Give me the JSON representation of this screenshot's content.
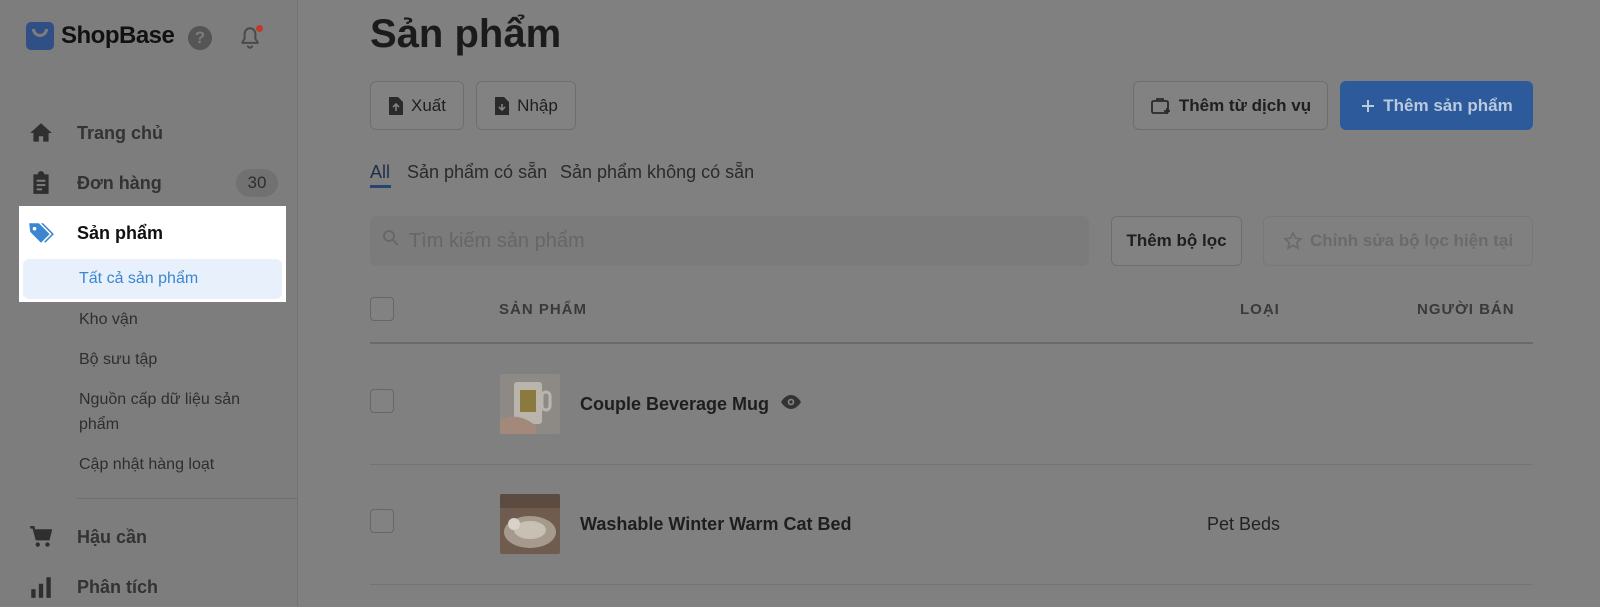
{
  "brand": {
    "name": "ShopBase"
  },
  "sidebar": {
    "items": [
      {
        "label": "Trang chủ",
        "icon": "home-icon"
      },
      {
        "label": "Đơn hàng",
        "icon": "clipboard-icon",
        "badge": "30"
      },
      {
        "label": "Sản phẩm",
        "icon": "tag-icon"
      },
      {
        "label": "Hậu cần",
        "icon": "cart-icon"
      },
      {
        "label": "Phân tích",
        "icon": "bar-chart-icon"
      }
    ],
    "subitems": [
      {
        "label": "Tất cả sản phẩm"
      },
      {
        "label": "Kho vận"
      },
      {
        "label": "Bộ sưu tập"
      },
      {
        "label": "Nguồn cấp dữ liệu sản phẩm"
      },
      {
        "label": "Cập nhật hàng loạt"
      }
    ]
  },
  "page": {
    "title": "Sản phẩm",
    "actions": {
      "export": "Xuất",
      "import": "Nhập",
      "add_from_service": "Thêm từ dịch vụ",
      "add_product": "Thêm sản phẩm"
    },
    "tabs": [
      "All",
      "Sản phẩm có sẵn",
      "Sản phẩm không có sẵn"
    ],
    "search": {
      "placeholder": "Tìm kiếm sản phẩm"
    },
    "filters": {
      "add": "Thêm bộ lọc",
      "edit_current": "Chỉnh sửa bộ lọc hiện tại"
    },
    "table": {
      "columns": [
        "SẢN PHẨM",
        "LOẠI",
        "NGƯỜI BÁN"
      ],
      "rows": [
        {
          "name": "Couple Beverage Mug",
          "type": "",
          "vendor": ""
        },
        {
          "name": "Washable Winter Warm Cat Bed",
          "type": "Pet Beds",
          "vendor": ""
        }
      ]
    }
  },
  "colors": {
    "primary": "#2c5a9a",
    "active_link": "#3b86d0",
    "notification_dot": "#c0392b"
  }
}
